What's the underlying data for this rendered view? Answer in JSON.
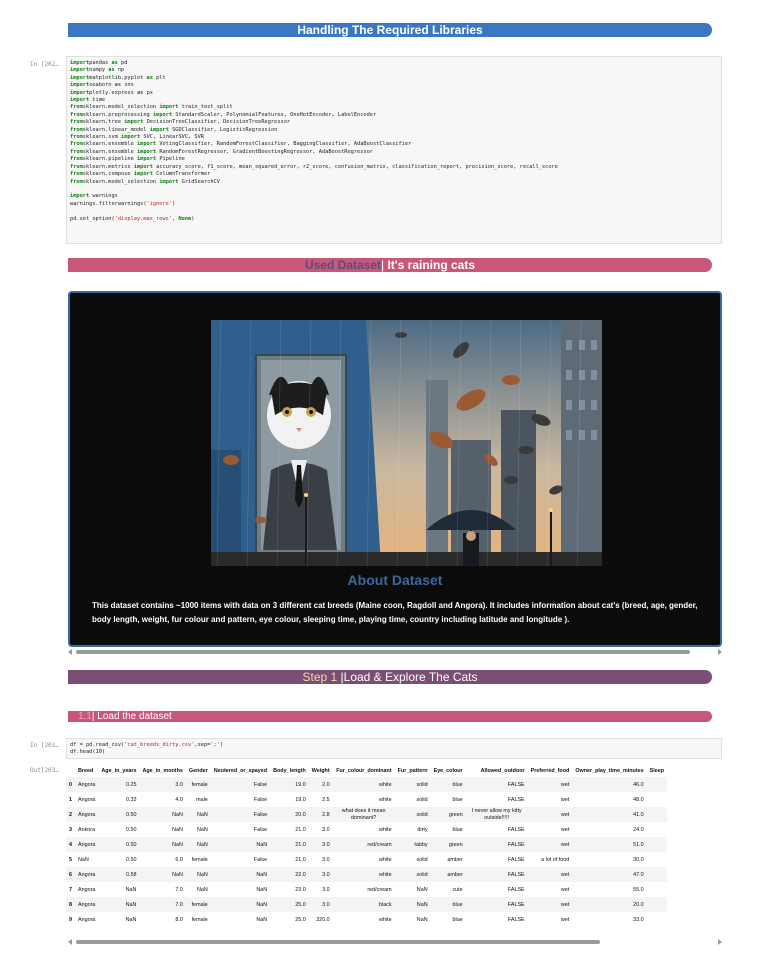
{
  "section1": {
    "title": "Handling The Required Libraries"
  },
  "cell1": {
    "prompt": "In [202…",
    "lines": [
      [
        [
          "kw",
          "import"
        ],
        [
          "",
          "pandas "
        ],
        [
          "kw",
          "as"
        ],
        [
          "",
          " pd"
        ]
      ],
      [
        [
          "kw",
          "import"
        ],
        [
          "",
          "numpy "
        ],
        [
          "kw",
          "as"
        ],
        [
          "",
          " np"
        ]
      ],
      [
        [
          "kw",
          "import"
        ],
        [
          "",
          "matplotlib.pyplot "
        ],
        [
          "kw",
          "as"
        ],
        [
          "",
          " plt"
        ]
      ],
      [
        [
          "kw",
          "import"
        ],
        [
          "",
          "seaborn "
        ],
        [
          "kw",
          "as"
        ],
        [
          "",
          " sns"
        ]
      ],
      [
        [
          "kw",
          "import"
        ],
        [
          "",
          "plotly.express "
        ],
        [
          "kw",
          "as"
        ],
        [
          "",
          " px"
        ]
      ],
      [
        [
          "kw",
          "import"
        ],
        [
          "",
          " time"
        ]
      ],
      [
        [
          "kw",
          "from"
        ],
        [
          "",
          "sklearn.model_selection "
        ],
        [
          "kw",
          "import"
        ],
        [
          "",
          " train_test_split"
        ]
      ],
      [
        [
          "kw",
          "from"
        ],
        [
          "",
          "sklearn.preprocessing "
        ],
        [
          "kw",
          "import"
        ],
        [
          "",
          " StandardScaler, PolynomialFeatures, OneHotEncoder, LabelEncoder"
        ]
      ],
      [
        [
          "kw",
          "from"
        ],
        [
          "",
          "sklearn.tree "
        ],
        [
          "kw",
          "import"
        ],
        [
          "",
          " DecisionTreeClassifier, DecisionTreeRegressor"
        ]
      ],
      [
        [
          "kw",
          "from"
        ],
        [
          "",
          "sklearn.linear_model "
        ],
        [
          "kw",
          "import"
        ],
        [
          "",
          " SGDClassifier, LogisticRegression"
        ]
      ],
      [
        [
          "kw",
          "from"
        ],
        [
          "",
          "sklearn.svm "
        ],
        [
          "kw",
          "import"
        ],
        [
          "",
          " SVC, LinearSVC, SVR"
        ]
      ],
      [
        [
          "kw",
          "from"
        ],
        [
          "",
          "sklearn.ensemble "
        ],
        [
          "kw",
          "import"
        ],
        [
          "",
          " VotingClassifier, RandomForestClassifier, BaggingClassifier, AdaBoostClassifier"
        ]
      ],
      [
        [
          "kw",
          "from"
        ],
        [
          "",
          "sklearn.ensemble "
        ],
        [
          "kw",
          "import"
        ],
        [
          "",
          " RandomForestRegressor, GradientBoostingRegressor, AdaBoostRegressor"
        ]
      ],
      [
        [
          "kw",
          "from"
        ],
        [
          "",
          "sklearn.pipeline "
        ],
        [
          "kw",
          "import"
        ],
        [
          "",
          " Pipeline"
        ]
      ],
      [
        [
          "kw",
          "from"
        ],
        [
          "",
          "sklearn.metrics "
        ],
        [
          "kw",
          "import"
        ],
        [
          "",
          " accuracy_score, f1_score, mean_squared_error, r2_score, confusion_matrix, classification_report, precision_score, recall_score"
        ]
      ],
      [
        [
          "kw",
          "from"
        ],
        [
          "",
          "sklearn.compose "
        ],
        [
          "kw",
          "import"
        ],
        [
          "",
          " ColumnTransformer"
        ]
      ],
      [
        [
          "kw",
          "from"
        ],
        [
          "",
          "sklearn.model_selection "
        ],
        [
          "kw",
          "import"
        ],
        [
          "",
          " GridSearchCV"
        ]
      ],
      [],
      [
        [
          "kw",
          "import"
        ],
        [
          "",
          " warnings"
        ]
      ],
      [
        [
          "",
          "warnings.filterwarnings("
        ],
        [
          "str",
          "'ignore'"
        ],
        [
          "",
          ")"
        ]
      ],
      [],
      [
        [
          "",
          "pd.set_option("
        ],
        [
          "str",
          "'display.max_rows'"
        ],
        [
          "",
          ", "
        ],
        [
          "kw",
          "None"
        ],
        [
          "",
          ")"
        ]
      ]
    ]
  },
  "section2": {
    "part1": "Used Dataset",
    "sep": "|",
    "part2": " It's raining cats"
  },
  "about": {
    "title": "About Dataset",
    "text": "This dataset contains ~1000 items with data on 3 different cat breeds (Maine coon, Ragdoll and Angora). It includes information about cat's (breed, age, gender, body length, weight, fur colour and pattern, eye colour, sleeping time, playing time, country including latitude and longitude )."
  },
  "section3": {
    "step": "Step 1 ",
    "sep": "|",
    "title": "Load & Explore The Cats"
  },
  "section31": {
    "num": "1.1",
    "sep": "|",
    "title": " Load the dataset"
  },
  "cell2": {
    "prompt": "In [203…",
    "lines": [
      [
        [
          "",
          "df = pd.read_csv("
        ],
        [
          "str",
          "'cat_breeds_dirty.csv'"
        ],
        [
          "",
          ","
        ],
        [
          "",
          "sep="
        ],
        [
          "str",
          "';'"
        ],
        [
          "",
          ")"
        ]
      ],
      [
        [
          "",
          "df.head("
        ],
        [
          "",
          "10"
        ],
        [
          "",
          ")"
        ]
      ]
    ]
  },
  "out2": {
    "prompt": "Out[203…"
  },
  "table": {
    "columns": [
      "",
      "Breed",
      "Age_in_years",
      "Age_in_months",
      "Gender",
      "Neutered_or_spayed",
      "Body_length",
      "Weight",
      "Fur_colour_dominant",
      "Fur_pattern",
      "Eye_colour",
      "Allowed_outdoor",
      "Preferred_food",
      "Owner_play_time_minutes",
      "Sleep"
    ],
    "rows": [
      [
        "0",
        "Angora",
        "0.25",
        "3.0",
        "female",
        "False",
        "19.0",
        "2.0",
        "white",
        "solid",
        "blue",
        "FALSE",
        "wet",
        "46.0",
        ""
      ],
      [
        "1",
        "Angora",
        "0.33",
        "4.0",
        "male",
        "False",
        "19.0",
        "2.5",
        "white",
        "solid",
        "blue",
        "FALSE",
        "wet",
        "48.0",
        ""
      ],
      [
        "2",
        "Angora",
        "0.50",
        "NaN",
        "NaN",
        "False",
        "20.0",
        "2.8",
        "what does it mean dominant?",
        "solid",
        "green",
        "I never allow my kitty outside!!!!!",
        "wet",
        "41.0",
        ""
      ],
      [
        "3",
        "Ankora",
        "0.50",
        "NaN",
        "NaN",
        "False",
        "21.0",
        "3.0",
        "white",
        "dirty",
        "blue",
        "FALSE",
        "wet",
        "24.0",
        ""
      ],
      [
        "4",
        "Angora",
        "0.50",
        "NaN",
        "NaN",
        "NaN",
        "21.0",
        "3.0",
        "red/cream",
        "tabby",
        "green",
        "FALSE",
        "wet",
        "51.0",
        ""
      ],
      [
        "5",
        "NaN",
        "0.50",
        "6.0",
        "female",
        "False",
        "21.0",
        "3.0",
        "white",
        "solid",
        "amber",
        "FALSE",
        "a lot of food",
        "30.0",
        ""
      ],
      [
        "6",
        "Angora",
        "0.58",
        "NaN",
        "NaN",
        "NaN",
        "22.0",
        "3.0",
        "white",
        "solid",
        "amber",
        "FALSE",
        "wet",
        "47.0",
        ""
      ],
      [
        "7",
        "Angora",
        "NaN",
        "7.0",
        "NaN",
        "NaN",
        "23.0",
        "3.0",
        "red/cream",
        "NaN",
        "cute",
        "FALSE",
        "wet",
        "55.0",
        ""
      ],
      [
        "8",
        "Angora",
        "NaN",
        "7.0",
        "female",
        "NaN",
        "25.0",
        "3.0",
        "black",
        "NaN",
        "blue",
        "FALSE",
        "wet",
        "20.0",
        ""
      ],
      [
        "9",
        "Angora",
        "NaN",
        "8.0",
        "female",
        "NaN",
        "25.0",
        "320.0",
        "white",
        "NaN",
        "blue",
        "FALSE",
        "wet",
        "33.0",
        ""
      ]
    ]
  },
  "colors": {
    "blue_banner": "#3b78c4",
    "pink_banner": "#c8577a",
    "purple_banner": "#7b4f73",
    "about_border": "#3b6a9c"
  }
}
